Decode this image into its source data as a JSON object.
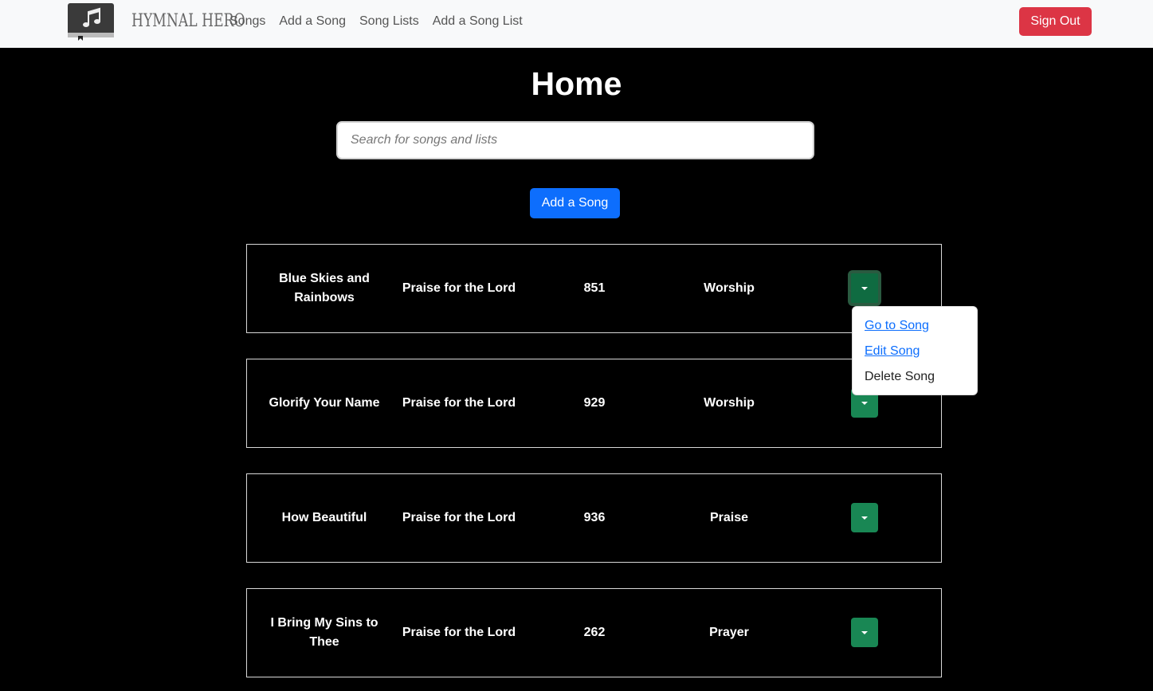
{
  "brand": {
    "logo_icon": "music-book-icon",
    "name": "HYMNAL HERO"
  },
  "nav": {
    "links": [
      "Songs",
      "Add a Song",
      "Song Lists",
      "Add a Song List"
    ],
    "sign_out": "Sign Out"
  },
  "page": {
    "title": "Home",
    "search_placeholder": "Search for songs and lists",
    "add_song_label": "Add a Song"
  },
  "songs": [
    {
      "title": "Blue Skies and Rainbows",
      "book": "Praise for the Lord",
      "number": "851",
      "category": "Worship"
    },
    {
      "title": "Glorify Your Name",
      "book": "Praise for the Lord",
      "number": "929",
      "category": "Worship"
    },
    {
      "title": "How Beautiful",
      "book": "Praise for the Lord",
      "number": "936",
      "category": "Praise"
    },
    {
      "title": "I Bring My Sins to Thee",
      "book": "Praise for the Lord",
      "number": "262",
      "category": "Prayer"
    }
  ],
  "dropdown": {
    "items": [
      "Go to Song",
      "Edit Song",
      "Delete Song"
    ]
  },
  "colors": {
    "navbar_bg": "#f8f9fa",
    "page_bg": "#000000",
    "primary": "#0d6efd",
    "danger": "#dc3545",
    "success": "#198754"
  }
}
